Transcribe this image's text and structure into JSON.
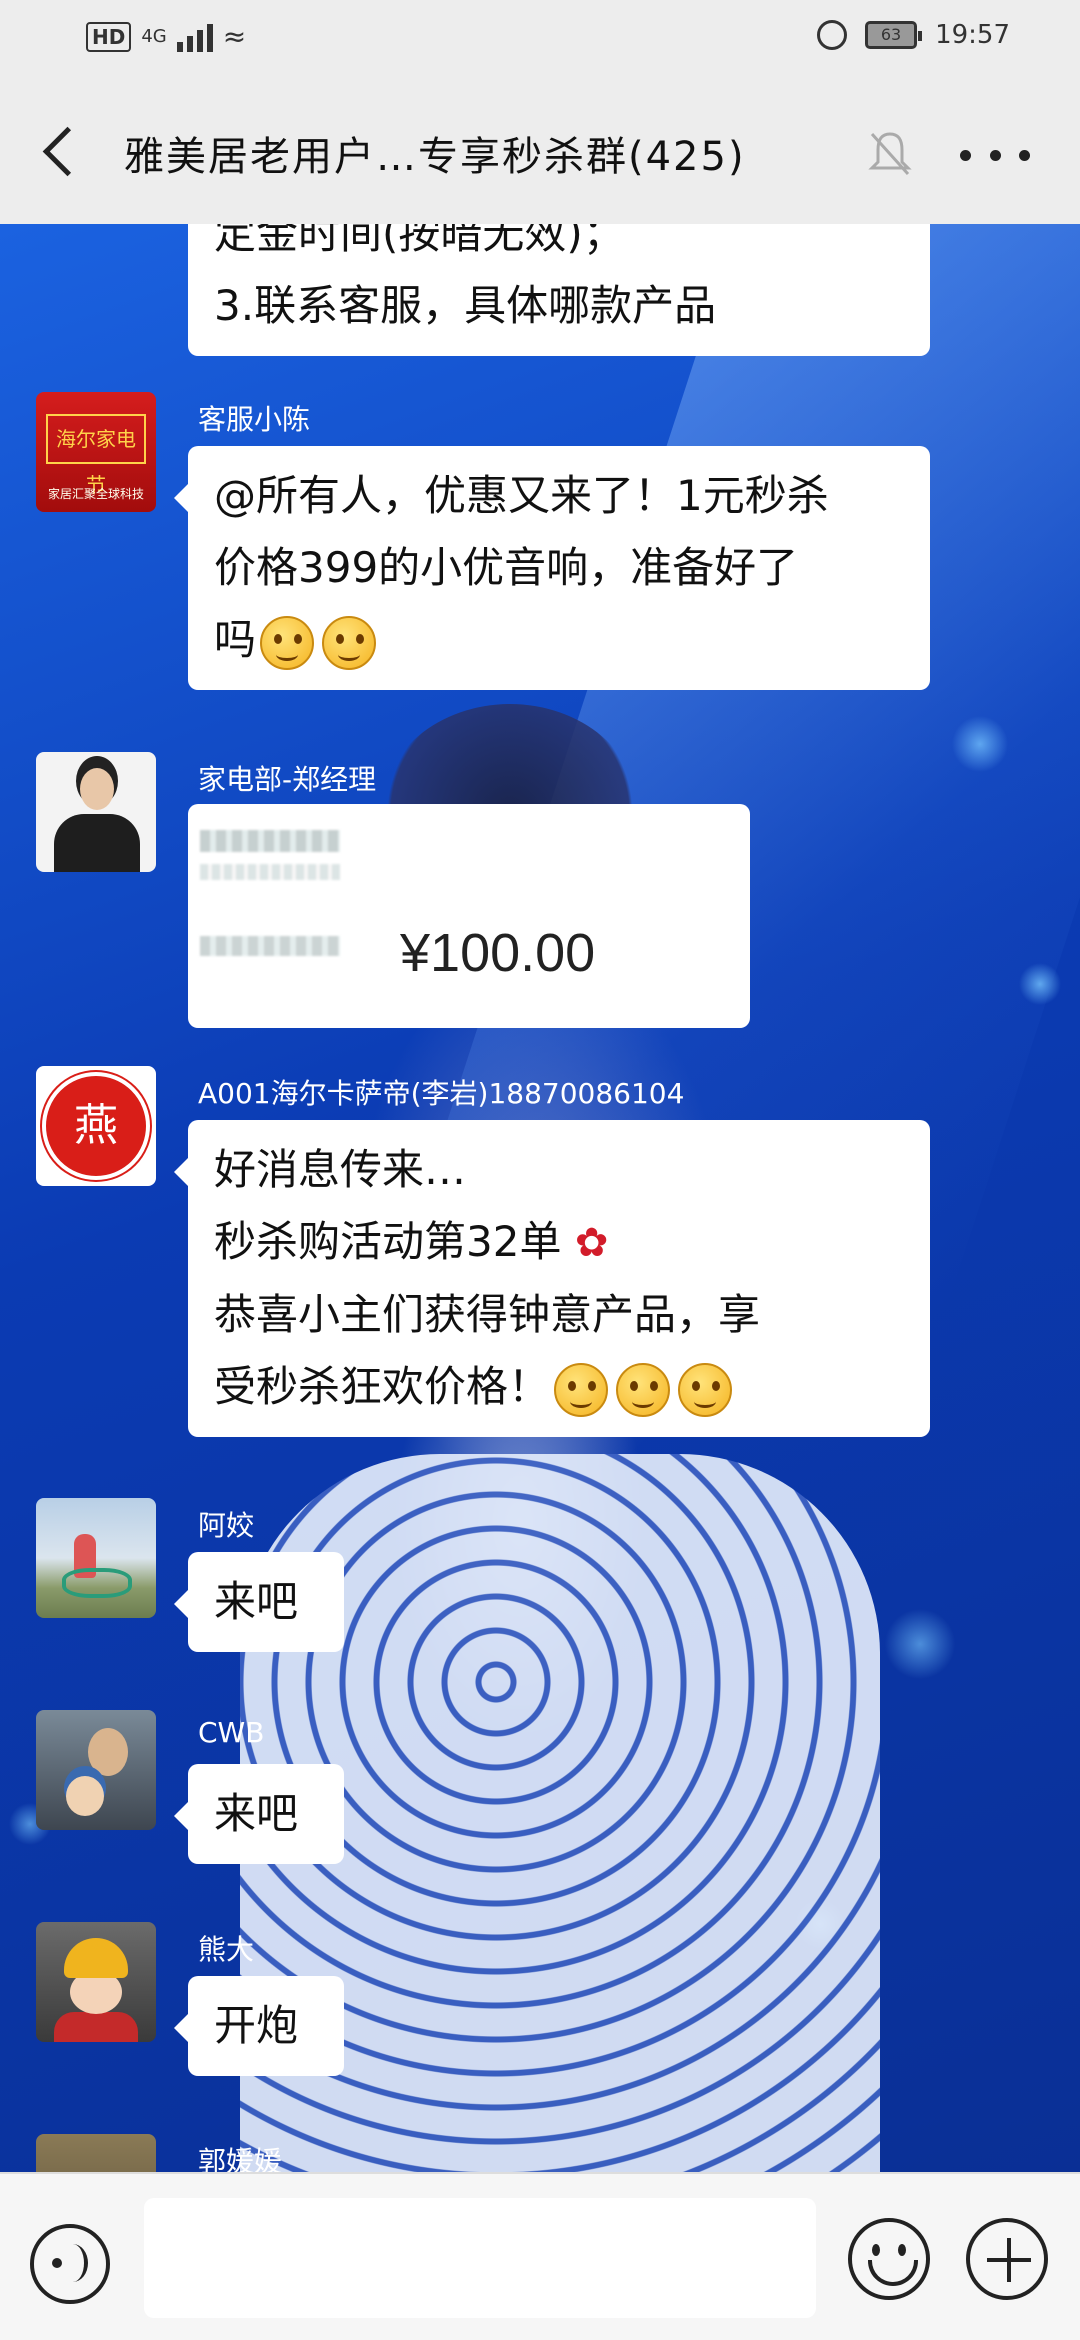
{
  "status_bar": {
    "hd": "HD",
    "network": "4G",
    "battery": "63",
    "time": "19:57"
  },
  "header": {
    "title": "雅美居老用户…专享秒杀群(425)"
  },
  "messages": [
    {
      "id": "m0",
      "lines": [
        "定金时间(按暗无效)；",
        "3.联系客服，具体哪款产品"
      ]
    },
    {
      "id": "m1",
      "sender": "客服小陈",
      "avatar_text": "海尔家电节",
      "avatar_foot": "家居汇聚全球科技",
      "lines": [
        "@所有人，优惠又来了！1元秒杀",
        "价格399的小优音响，准备好了",
        "吗"
      ],
      "emojis": [
        "smile",
        "smile"
      ]
    },
    {
      "id": "m2",
      "sender": "家电部-郑经理",
      "transfer_amount": "¥100.00"
    },
    {
      "id": "m3",
      "sender": "A001海尔卡萨帝(李岩)18870086104",
      "avatar_text": "燕",
      "lines": [
        "好消息传来…",
        "秒杀购活动第32单",
        "恭喜小主们获得钟意产品，享",
        "受秒杀狂欢价格！"
      ],
      "emojis": [
        "hug",
        "hug",
        "hug"
      ]
    },
    {
      "id": "m4",
      "sender": "阿姣",
      "lines": [
        "来吧"
      ]
    },
    {
      "id": "m5",
      "sender": "CWB",
      "lines": [
        "来吧"
      ]
    },
    {
      "id": "m6",
      "sender": "熊大",
      "lines": [
        "开炮"
      ]
    },
    {
      "id": "m7",
      "sender": "郭媛媛"
    }
  ]
}
